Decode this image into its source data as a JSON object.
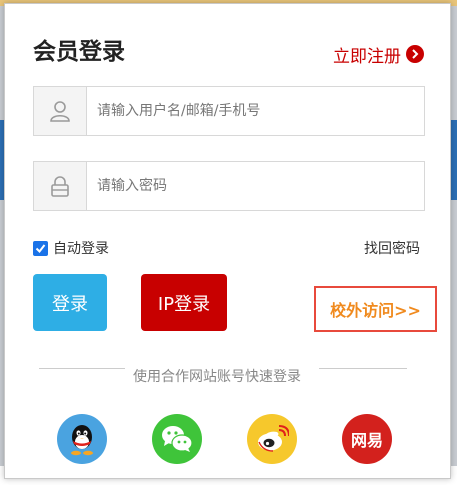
{
  "modal": {
    "title": "会员登录",
    "register_label": "立即注册"
  },
  "form": {
    "username_placeholder": "请输入用户名/邮箱/手机号",
    "password_placeholder": "请输入密码",
    "auto_login_label": "自动登录",
    "auto_login_checked": true,
    "forgot_label": "找回密码"
  },
  "buttons": {
    "login_label": "登录",
    "ip_login_label": "IP登录",
    "campus_label": "校外访问>>"
  },
  "partners": {
    "divider_text": "使用合作网站账号快速登录",
    "items": [
      {
        "name": "qq-icon"
      },
      {
        "name": "wechat-icon"
      },
      {
        "name": "weibo-icon"
      },
      {
        "name": "netease-icon",
        "label": "网易"
      }
    ]
  },
  "background": {
    "bottom_text": "…"
  },
  "colors": {
    "accent_red": "#c80000",
    "login_blue": "#2eaee5",
    "campus_orange": "#f08a1e",
    "campus_border": "#e84a3c",
    "checkbox_blue": "#1a73e8"
  }
}
